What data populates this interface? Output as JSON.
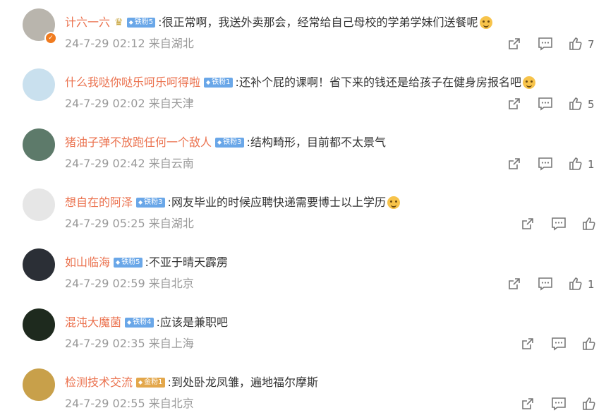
{
  "comments": [
    {
      "name": "计六一六",
      "crown": "♛",
      "badge": "铁粉5",
      "badge_type": "blue",
      "text": ":很正常啊，我送外卖那会，经常给自己母校的学弟学妹们送餐呢",
      "emoji": "smile",
      "meta": "24-7-29 02:12 来自湖北",
      "likes": "7",
      "avatar_color": "#b9b5ad",
      "verified": true
    },
    {
      "name": "什么我哒你哒乐呵乐呵得啦",
      "badge": "铁粉1",
      "badge_type": "blue",
      "text": ":还补个屁的课啊！省下来的钱还是给孩子在健身房报名吧",
      "emoji": "cry",
      "meta": "24-7-29 02:02 来自天津",
      "likes": "5",
      "avatar_color": "#c9e0ee"
    },
    {
      "name": "猪油子弹不放跑任何一个敌人",
      "badge": "铁粉3",
      "badge_type": "blue",
      "text": ":结构畸形，目前都不太景气",
      "meta": "24-7-29 02:42 来自云南",
      "likes": "1",
      "avatar_color": "#5d7a6a"
    },
    {
      "name": "想自在的阿泽",
      "badge": "铁粉3",
      "badge_type": "blue",
      "text": ":网友毕业的时候应聘快递需要博士以上学历",
      "emoji": "cat",
      "meta": "24-7-29 05:25 来自湖北",
      "likes": "",
      "avatar_color": "#e6e6e6"
    },
    {
      "name": "如山临海",
      "badge": "铁粉5",
      "badge_type": "blue",
      "text": ":不亚于晴天霹雳",
      "meta": "24-7-29 02:59 来自北京",
      "likes": "1",
      "avatar_color": "#2b2f36"
    },
    {
      "name": "混沌大魔菌",
      "badge": "铁粉4",
      "badge_type": "blue",
      "text": ":应该是兼职吧",
      "meta": "24-7-29 02:35 来自上海",
      "likes": "",
      "avatar_color": "#1e2a1e"
    },
    {
      "name": "检测技术交流",
      "badge": "金粉1",
      "badge_type": "gold",
      "text": ":到处卧龙凤雏，遍地福尔摩斯",
      "meta": "24-7-29 02:55 来自北京",
      "likes": "",
      "avatar_color": "#c8a04a"
    }
  ],
  "icons": {
    "share": "share-icon",
    "comment": "comment-icon",
    "like": "like-icon"
  },
  "colors": {
    "username": "#eb7350",
    "badge_blue": "#6aa7e8",
    "badge_gold": "#e3a74b",
    "meta": "#999999"
  }
}
